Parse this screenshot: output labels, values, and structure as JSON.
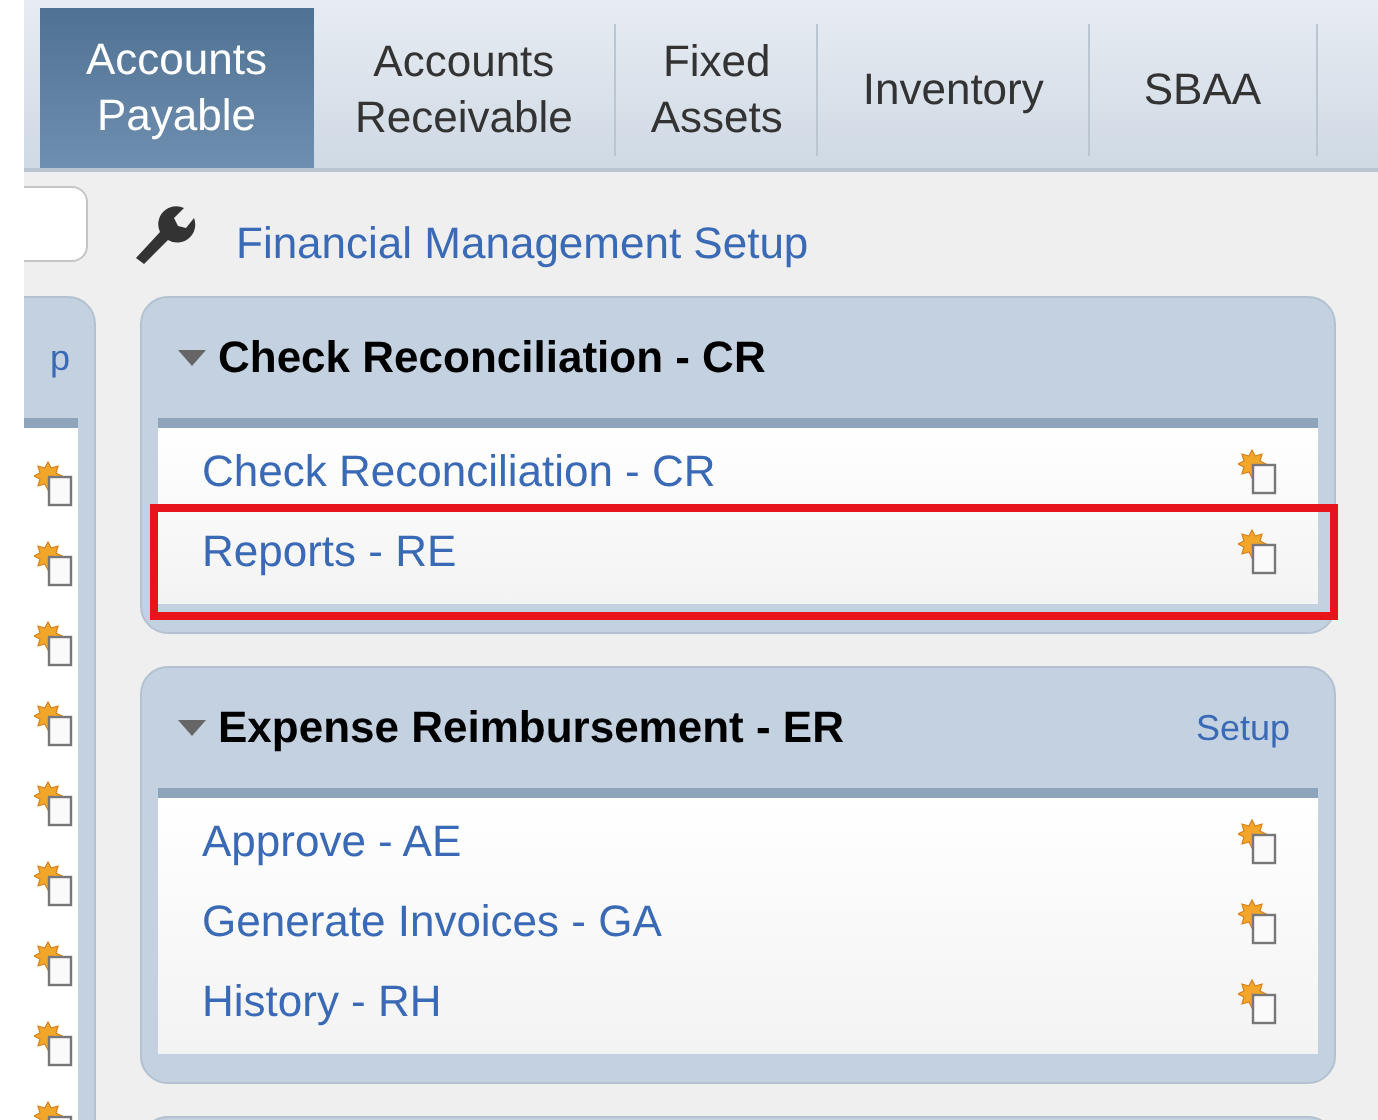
{
  "tabs": [
    {
      "lines": [
        "Accounts",
        "Payable"
      ],
      "selected": true
    },
    {
      "lines": [
        "Accounts",
        "Receivable"
      ],
      "selected": false
    },
    {
      "lines": [
        "Fixed",
        "Assets"
      ],
      "selected": false
    },
    {
      "lines": [
        "Inventory"
      ],
      "selected": false
    },
    {
      "lines": [
        "SBAA"
      ],
      "selected": false
    }
  ],
  "toolbar": {
    "setup_link": "Financial Management Setup"
  },
  "left_panel": {
    "header_link": "p"
  },
  "panels": [
    {
      "title": "Check Reconciliation - CR",
      "expanded": true,
      "items": [
        {
          "label": "Check Reconciliation - CR",
          "highlighted": false
        },
        {
          "label": "Reports - RE",
          "highlighted": true
        }
      ]
    },
    {
      "title": "Expense Reimbursement - ER",
      "expanded": true,
      "setup_link": "Setup",
      "items": [
        {
          "label": "Approve - AE",
          "highlighted": false
        },
        {
          "label": "Generate Invoices - GA",
          "highlighted": false
        },
        {
          "label": "History - RH",
          "highlighted": false
        }
      ]
    }
  ]
}
